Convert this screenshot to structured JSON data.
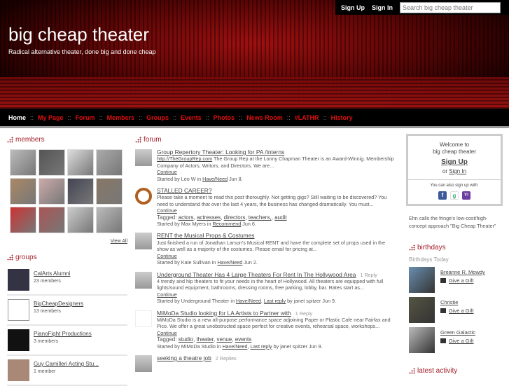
{
  "topbar": {
    "sign_up": "Sign Up",
    "sign_in": "Sign In",
    "search_placeholder": "Search big cheap theater"
  },
  "site": {
    "title": "big cheap theater",
    "tagline": "Radical alternative theater, done big and done cheap"
  },
  "nav": [
    "Home",
    "My Page",
    "Forum",
    "Members",
    "Groups",
    "Events",
    "Photos",
    "News Room",
    "#LATHR",
    "History"
  ],
  "nav_sep": "::",
  "members": {
    "title": "members",
    "view_all": "View All"
  },
  "groups": {
    "title": "groups",
    "items": [
      {
        "name": "CalArts Alumni",
        "count": "23 members"
      },
      {
        "name": "BigCheapDesigners",
        "count": "13 members"
      },
      {
        "name": "PianoFight Productions",
        "count": "3 members"
      },
      {
        "name": "Guy Camilleri Acting Stu...",
        "count": "1 member"
      }
    ]
  },
  "forum": {
    "title": "forum",
    "posts": [
      {
        "title": "Group Repertory Theater: Looking for PA /Interns",
        "replies": "",
        "link": "http://TheGroupRep.com",
        "body": " The Group Rep at the Lonny Chapman Theater is an Award-Winnig. Membership Company of Actors, Writors, and Directors. We are...",
        "continue": "Continue",
        "tags": [],
        "started": "Started by Leo W in ",
        "category": "Have/Need",
        "last": "",
        "date": " Jun 8."
      },
      {
        "title": "STALLED CAREER?",
        "replies": "",
        "link": "",
        "body": "Please take a moment to read this post thoroughly. Not getting gigs? Still waiting to be discovered? You need to understand that over the last 4 years, the business has changed dramatically. You must...",
        "continue": "Continue",
        "tags": [
          "actors",
          "actresses",
          "directors",
          "teachers,",
          "audit"
        ],
        "started": "Started by Max Myers in ",
        "category": "Recommend",
        "last": "",
        "date": " Jun 6."
      },
      {
        "title": "RENT the Musical Props & Costumes",
        "replies": "",
        "link": "",
        "body": "Just finished a run of Jonathan Larson's Musical RENT and have the complete set of props used in the show as well as a majority of the costumes. Please email for pricing at...",
        "continue": "Continue",
        "tags": [],
        "started": "Started by Kate Sullivan in ",
        "category": "Have/Need",
        "last": "",
        "date": " Jun 2."
      },
      {
        "title": "Underground Theater Has 4 Large Theaters For Rent In The Hollywood Area",
        "replies": "1 Reply",
        "link": "",
        "body": "4 trendy and hip theaters to fit your needs in the heart of Hollywood.  All theaters are equipped with full lights/sound equipment, bathrooms, dressing rooms, free parking, lobby, bar. Rates start as...",
        "continue": "Continue",
        "tags": [],
        "started": "Started by Underground Theater in ",
        "category": "Have/Need",
        "last": "Last reply",
        "date": " by janet spitzer Jun 9."
      },
      {
        "title": "MiMoDa Studio looking for LA Artists to Partner with",
        "replies": "1 Reply",
        "link": "",
        "body": "MiMoDa Studio is a new all-purpose performance space adjoining Paper or Plastic Cafe near Fairfax and Pico. We offer a great unobstructed space perfect for creative events, rehearsal space, workshops...",
        "continue": "Continue",
        "tags": [
          "studio",
          "theater",
          "venue",
          "events"
        ],
        "started": "Started by MiMoDa Studio in ",
        "category": "Have/Need",
        "last": "Last reply",
        "date": " by janet spitzer Jun 9."
      },
      {
        "title": "seeking a theatre job",
        "replies": "2 Replies",
        "link": "",
        "body": "",
        "continue": "",
        "tags": [],
        "started": "",
        "category": "",
        "last": "",
        "date": ""
      }
    ],
    "tagged_label": "Tagged: "
  },
  "welcome": {
    "line1": "Welcome to",
    "line2": "big cheap theater",
    "sign_up": "Sign Up",
    "or": "or ",
    "sign_in": "Sign In",
    "also": "You can also sign up with:",
    "facebook": "f",
    "google": "g",
    "yahoo": "Y!"
  },
  "quote": "Ehn calls the fringe's low-cost/high-concept approach \"Big Cheap Theater\"",
  "birthdays": {
    "title": "birthdays",
    "today": "Birthdays Today",
    "gift": "Give a Gift",
    "people": [
      "Breanne R. Mowdy",
      "Christie",
      "Green Galactic"
    ]
  },
  "latest_activity": {
    "title": "latest activity"
  }
}
